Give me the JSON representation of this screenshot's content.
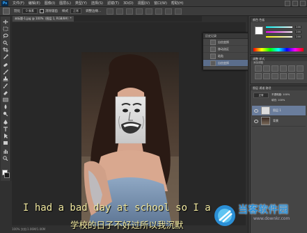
{
  "app": {
    "logo": "Ps"
  },
  "menu": [
    "文件(F)",
    "编辑(E)",
    "图像(I)",
    "图层(L)",
    "类型(Y)",
    "选择(S)",
    "滤镜(T)",
    "3D(D)",
    "视图(V)",
    "窗口(W)",
    "帮助(H)"
  ],
  "options": {
    "feather_label": "羽化",
    "feather_value": "0 像素",
    "antialias_label": "消除锯齿",
    "style_label": "样式",
    "style_value": "正常",
    "refine_label": "调整边缘..."
  },
  "document": {
    "tab_label": "未标题-1.jpg @ 100%（图层 1, RGB/8#）*"
  },
  "status": {
    "zoom_text": "100%   文档:1.06M/1.06M"
  },
  "history": {
    "header": "历史记录",
    "items": [
      {
        "label": "自由变换",
        "active": false
      },
      {
        "label": "移动选区",
        "active": false
      },
      {
        "label": "粘贴",
        "active": false
      },
      {
        "label": "自由变换",
        "active": true
      }
    ]
  },
  "panels": {
    "color_tab": "颜色   色板",
    "color_values": {
      "r": "246",
      "g": "246",
      "b": "246"
    },
    "adjust_tab": "调整   样式",
    "adjust_label": "添加调整",
    "layers_tab": "图层   通道   路径",
    "blend_mode": "正常",
    "opacity_label": "不透明度: 100%",
    "fill_label": "填充: 100%",
    "layers": [
      {
        "name": "图层 1",
        "active": true
      },
      {
        "name": "背景",
        "active": false
      }
    ]
  },
  "subtitles": {
    "english": "I had a bad day at school so I a",
    "chinese": "学校的日子不好过所以我沉默"
  },
  "watermark": {
    "name": "当客软件园",
    "url": "www.downkr.com"
  },
  "colors": {
    "subtitle": "#f1e9a0",
    "watermark": "#2a8fd8",
    "history_active": "#5b6e8c"
  }
}
